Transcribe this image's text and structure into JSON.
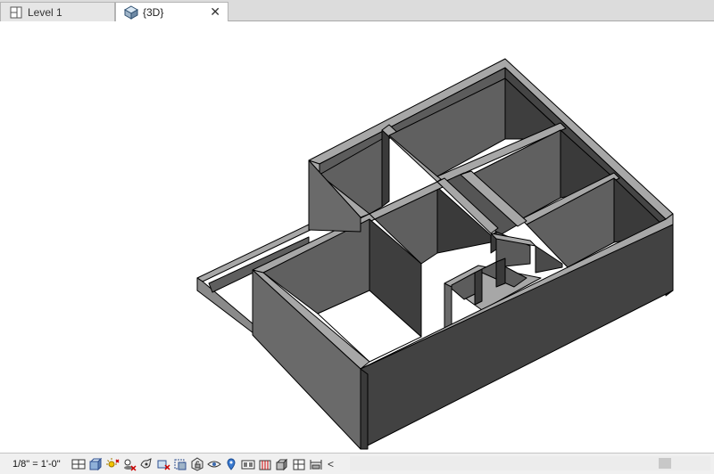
{
  "tabs": [
    {
      "label": "Level 1",
      "icon": "floor-plan-icon",
      "active": false
    },
    {
      "label": "{3D}",
      "icon": "3d-house-icon",
      "active": true,
      "close": "✕"
    }
  ],
  "viewport": {
    "content": "3d-isometric-model",
    "colors": {
      "wall_top": "#a7a7a7",
      "wall_left": "#6a6a6a",
      "wall_right": "#3a3a3a",
      "wall_dark": "#2e2e2e",
      "edge": "#000000"
    }
  },
  "view_controls": {
    "scale": "1/8\" = 1'-0\"",
    "buttons": [
      "detail-level-icon",
      "visual-style-icon",
      "sun-path-icon",
      "shadows-icon",
      "rendering-icon",
      "crop-view-icon",
      "show-crop-region-icon",
      "unlock-3d-view-icon",
      "temporary-hide-icon",
      "reveal-hidden-icon",
      "worksharing-icon",
      "design-options-icon",
      "highlight-displacement-icon",
      "analytical-model-icon",
      "constraints-icon",
      "reveal-constraints-icon"
    ],
    "collapse": "<"
  }
}
